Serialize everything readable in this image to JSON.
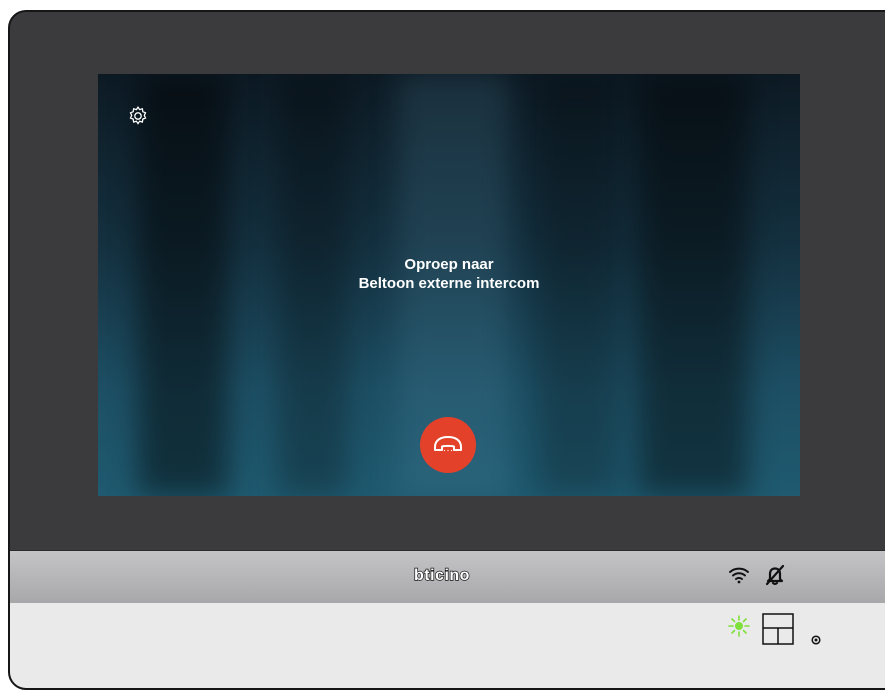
{
  "screen": {
    "call_line1": "Oproep naar",
    "call_line2": "Beltoon externe intercom",
    "settings_icon": "gear-icon",
    "hangup_icon": "phone-hangup-icon",
    "hangup_color": "#e4412a"
  },
  "brand_bar": {
    "logo_text": "bticino",
    "status_icons": [
      "wifi-icon",
      "mute-ringer-icon"
    ]
  },
  "bottom_panel": {
    "led_color": "#7ee03a",
    "controls": [
      "status-led-icon",
      "layout-key-icon",
      "light-sensor-icon"
    ]
  }
}
